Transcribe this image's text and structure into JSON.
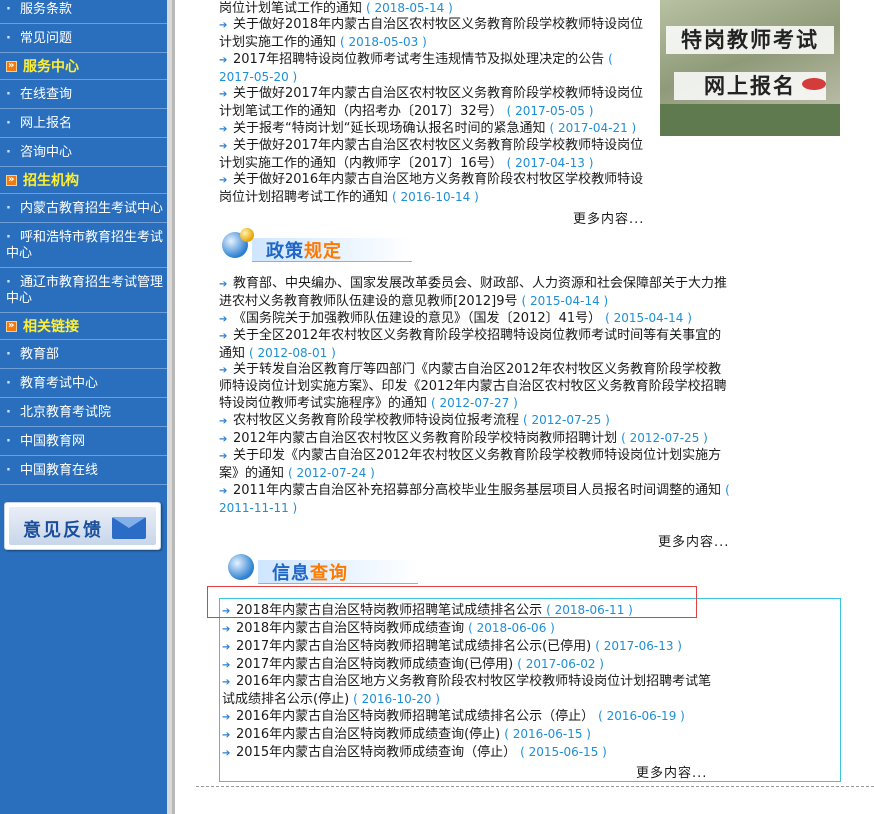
{
  "sidebar": {
    "top_items": [
      {
        "label": "服务条款"
      },
      {
        "label": "常见问题"
      }
    ],
    "sections": [
      {
        "title": "服务中心",
        "items": [
          {
            "label": "在线查询"
          },
          {
            "label": "网上报名"
          },
          {
            "label": "咨询中心"
          }
        ]
      },
      {
        "title": "招生机构",
        "items": [
          {
            "label": "内蒙古教育招生考试中心"
          },
          {
            "label": "呼和浩特市教育招生考试中心"
          },
          {
            "label": "通辽市教育招生考试管理中心"
          }
        ]
      },
      {
        "title": "相关链接",
        "items": [
          {
            "label": "教育部"
          },
          {
            "label": "教育考试中心"
          },
          {
            "label": "北京教育考试院"
          },
          {
            "label": "中国教育网"
          },
          {
            "label": "中国教育在线"
          }
        ]
      }
    ],
    "feedback_label": "意见反馈"
  },
  "promo": {
    "line1": "特岗教师考试",
    "line2": "网上报名"
  },
  "news": {
    "items": [
      {
        "title": "岗位计划笔试工作的通知",
        "date": "( 2018-05-14 )"
      },
      {
        "title": "关于做好2018年内蒙古自治区农村牧区义务教育阶段学校教师特设岗位计划实施工作的通知",
        "date": "( 2018-05-03 )"
      },
      {
        "title": "2017年招聘特设岗位教师考试考生违规情节及拟处理决定的公告",
        "date": "( 2017-05-20 )"
      },
      {
        "title": "关于做好2017年内蒙古自治区农村牧区义务教育阶段学校教师特设岗位计划笔试工作的通知（内招考办〔2017〕32号）",
        "date": "( 2017-05-05 )"
      },
      {
        "title": "关于报考“特岗计划“延长现场确认报名时间的紧急通知",
        "date": "( 2017-04-21 )"
      },
      {
        "title": "关于做好2017年内蒙古自治区农村牧区义务教育阶段学校教师特设岗位计划实施工作的通知（内教师字〔2017〕16号）",
        "date": "( 2017-04-13 )"
      },
      {
        "title": "关于做好2016年内蒙古自治区地方义务教育阶段农村牧区学校教师特设岗位计划招聘考试工作的通知",
        "date": "( 2016-10-14 )"
      }
    ],
    "more": "更多内容..."
  },
  "policy": {
    "title_main": "政策",
    "title_hl": "规定",
    "items": [
      {
        "title": "教育部、中央编办、国家发展改革委员会、财政部、人力资源和社会保障部关于大力推进农村义务教育教师队伍建设的意见教师[2012]9号",
        "date": "( 2015-04-14 )"
      },
      {
        "title": "《国务院关于加强教师队伍建设的意见》（国发〔2012〕41号）",
        "date": "( 2015-04-14 )"
      },
      {
        "title": "关于全区2012年农村牧区义务教育阶段学校招聘特设岗位教师考试时间等有关事宜的通知",
        "date": "( 2012-08-01 )"
      },
      {
        "title": "关于转发自治区教育厅等四部门《内蒙古自治区2012年农村牧区义务教育阶段学校教师特设岗位计划实施方案》、印发《2012年内蒙古自治区农村牧区义务教育阶段学校招聘特设岗位教师考试实施程序》的通知",
        "date": "( 2012-07-27 )"
      },
      {
        "title": "农村牧区义务教育阶段学校教师特设岗位报考流程",
        "date": "( 2012-07-25 )"
      },
      {
        "title": "2012年内蒙古自治区农村牧区义务教育阶段学校特岗教师招聘计划",
        "date": "( 2012-07-25 )"
      },
      {
        "title": "关于印发《内蒙古自治区2012年农村牧区义务教育阶段学校教师特设岗位计划实施方案》的通知",
        "date": "( 2012-07-24 )"
      },
      {
        "title": "2011年内蒙古自治区补充招募部分高校毕业生服务基层项目人员报名时间调整的通知",
        "date": "( 2011-11-11 )"
      }
    ],
    "more": "更多内容..."
  },
  "query": {
    "title_main": "信息",
    "title_hl": "查询",
    "items": [
      {
        "title": "2018年内蒙古自治区特岗教师招聘笔试成绩排名公示",
        "date": "( 2018-06-11 )"
      },
      {
        "title": "2018年内蒙古自治区特岗教师成绩查询",
        "date": "( 2018-06-06 )"
      },
      {
        "title": "2017年内蒙古自治区特岗教师招聘笔试成绩排名公示(已停用)",
        "date": "( 2017-06-13 )"
      },
      {
        "title": "2017年内蒙古自治区特岗教师成绩查询(已停用)",
        "date": "( 2017-06-02 )"
      },
      {
        "title": "2016年内蒙古自治区地方义务教育阶段农村牧区学校教师特设岗位计划招聘考试笔试成绩排名公示(停止)",
        "date": "( 2016-10-20 )"
      },
      {
        "title": "2016年内蒙古自治区特岗教师招聘笔试成绩排名公示（停止）",
        "date": "( 2016-06-19 )"
      },
      {
        "title": "2016年内蒙古自治区特岗教师成绩查询(停止)",
        "date": "( 2016-06-15 )"
      },
      {
        "title": "2015年内蒙古自治区特岗教师成绩查询（停止）",
        "date": "( 2015-06-15 )"
      }
    ],
    "more": "更多内容..."
  },
  "colors": {
    "sidebar": "#2a6fbd",
    "section_title": "#ffee33",
    "date": "#1d8fd6",
    "highlight_box": "#e04040",
    "info_border": "#39c6d8"
  }
}
